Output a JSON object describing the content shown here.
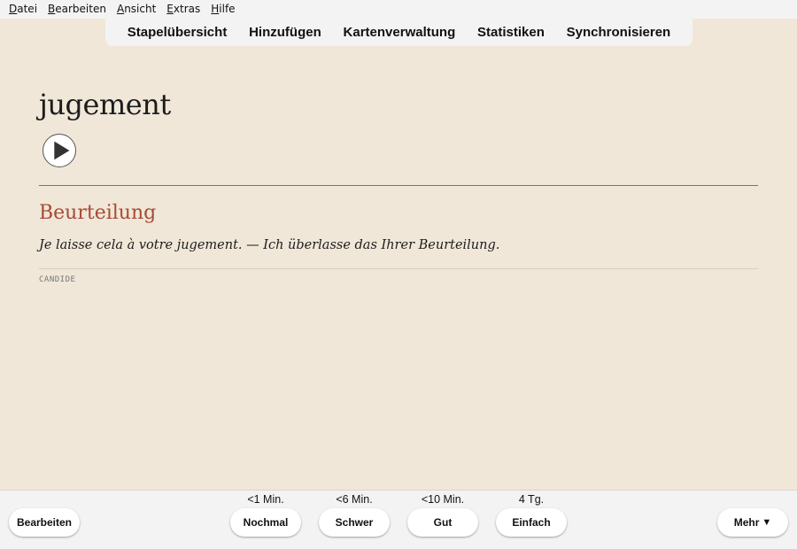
{
  "menubar": {
    "items": [
      {
        "accel": "D",
        "rest": "atei"
      },
      {
        "accel": "B",
        "rest": "earbeiten"
      },
      {
        "accel": "A",
        "rest": "nsicht"
      },
      {
        "accel": "E",
        "rest": "xtras"
      },
      {
        "accel": "H",
        "rest": "ilfe"
      }
    ]
  },
  "toolbar": {
    "decks": "Stapelübersicht",
    "add": "Hinzufügen",
    "browse": "Kartenverwaltung",
    "stats": "Statistiken",
    "sync": "Synchronisieren"
  },
  "card": {
    "front": "jugement",
    "audio_icon": "play-icon",
    "meaning": "Beurteilung",
    "example": "Je laisse cela à votre jugement. — Ich überlasse das Ihrer Beurteilung.",
    "source": "CANDIDE"
  },
  "bottombar": {
    "edit_label": "Bearbeiten",
    "more_label": "Mehr",
    "more_icon": "triangle-down-icon",
    "answers": [
      {
        "label": "Nochmal",
        "interval": "<1 Min."
      },
      {
        "label": "Schwer",
        "interval": "<6 Min."
      },
      {
        "label": "Gut",
        "interval": "<10 Min."
      },
      {
        "label": "Einfach",
        "interval": "4 Tg."
      }
    ]
  },
  "colors": {
    "background": "#f0e7d8",
    "meaning": "#a74a35",
    "chrome": "#f3f3f3"
  }
}
